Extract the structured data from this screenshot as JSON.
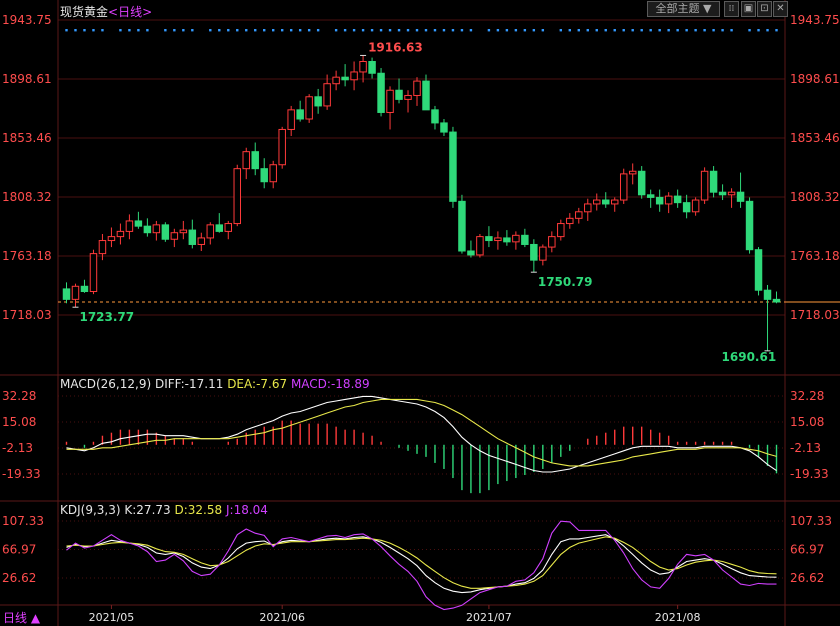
{
  "header": {
    "title": "现货黄金",
    "period_prefix": "<",
    "period": "日线",
    "period_suffix": ">",
    "theme_button": "全部主题",
    "theme_arrow": "▼",
    "win_buttons": [
      "⁞⁞",
      "▣",
      "⊡",
      "✕"
    ]
  },
  "macd": {
    "label": "MACD(26,12,9)",
    "diff_label": "DIFF:",
    "diff": "-17.11",
    "dea_label": "DEA:",
    "dea": "-7.67",
    "macd_label": "MACD:",
    "macd_value": "-18.89"
  },
  "kdj": {
    "label": "KDJ(9,3,3)",
    "k_label": "K:",
    "k": "27.73",
    "d_label": "D:",
    "d": "32.58",
    "j_label": "J:",
    "j": "18.04"
  },
  "footer": {
    "period": "日线",
    "arrow": "▲"
  },
  "colors": {
    "up": "#ff3a3a",
    "down": "#2fd97a",
    "axis_price": "#ff4d4d",
    "grid": "#4a1010",
    "diff_line": "#ffffff",
    "dea_line": "#e8e84a",
    "macd_text": "#d040ff",
    "j_line": "#d040ff",
    "high_label": "#ff4d4d",
    "low_label": "#2fd97a",
    "marker": "#3399ff"
  },
  "chart_data": [
    {
      "type": "candlestick",
      "name": "现货黄金 日线",
      "y_ticks": [
        1718.03,
        1763.18,
        1808.32,
        1853.46,
        1898.61,
        1943.75
      ],
      "ylim": [
        1718.03,
        1943.75
      ],
      "x_labels": [
        "2021/05",
        "2021/06",
        "2021/07",
        "2021/08"
      ],
      "annotations": [
        {
          "text": "1916.63",
          "type": "high"
        },
        {
          "text": "1723.77",
          "type": "low"
        },
        {
          "text": "1750.79",
          "type": "low"
        },
        {
          "text": "1690.61",
          "type": "low"
        }
      ],
      "last_price": 1728.0,
      "candles": [
        [
          1738,
          1743,
          1727,
          1730
        ],
        [
          1730,
          1742,
          1724,
          1740
        ],
        [
          1740,
          1745,
          1735,
          1736
        ],
        [
          1736,
          1768,
          1734,
          1765
        ],
        [
          1765,
          1780,
          1760,
          1775
        ],
        [
          1775,
          1785,
          1770,
          1778
        ],
        [
          1778,
          1788,
          1772,
          1782
        ],
        [
          1782,
          1795,
          1776,
          1790
        ],
        [
          1790,
          1797,
          1784,
          1786
        ],
        [
          1786,
          1792,
          1778,
          1781
        ],
        [
          1781,
          1790,
          1775,
          1787
        ],
        [
          1787,
          1789,
          1774,
          1776
        ],
        [
          1776,
          1784,
          1770,
          1781
        ],
        [
          1781,
          1790,
          1776,
          1783
        ],
        [
          1783,
          1791,
          1769,
          1772
        ],
        [
          1772,
          1781,
          1767,
          1777
        ],
        [
          1777,
          1789,
          1772,
          1787
        ],
        [
          1787,
          1796,
          1781,
          1782
        ],
        [
          1782,
          1790,
          1776,
          1788
        ],
        [
          1788,
          1833,
          1786,
          1830
        ],
        [
          1830,
          1846,
          1822,
          1843
        ],
        [
          1843,
          1850,
          1825,
          1830
        ],
        [
          1830,
          1838,
          1815,
          1820
        ],
        [
          1820,
          1836,
          1815,
          1833
        ],
        [
          1833,
          1862,
          1830,
          1860
        ],
        [
          1860,
          1878,
          1855,
          1875
        ],
        [
          1875,
          1882,
          1866,
          1868
        ],
        [
          1868,
          1887,
          1865,
          1885
        ],
        [
          1885,
          1891,
          1872,
          1878
        ],
        [
          1878,
          1902,
          1875,
          1895
        ],
        [
          1895,
          1905,
          1890,
          1900
        ],
        [
          1900,
          1910,
          1893,
          1898
        ],
        [
          1898,
          1912,
          1890,
          1904
        ],
        [
          1904,
          1916.63,
          1896,
          1912
        ],
        [
          1912,
          1915,
          1899,
          1903
        ],
        [
          1903,
          1907,
          1870,
          1873
        ],
        [
          1873,
          1893,
          1860,
          1890
        ],
        [
          1890,
          1899,
          1880,
          1883
        ],
        [
          1883,
          1890,
          1873,
          1886
        ],
        [
          1886,
          1900,
          1878,
          1897
        ],
        [
          1897,
          1902,
          1885,
          1875
        ],
        [
          1875,
          1878,
          1860,
          1865
        ],
        [
          1865,
          1868,
          1855,
          1858
        ],
        [
          1858,
          1862,
          1800,
          1805
        ],
        [
          1805,
          1810,
          1765,
          1767
        ],
        [
          1767,
          1775,
          1762,
          1764
        ],
        [
          1764,
          1780,
          1762,
          1778
        ],
        [
          1778,
          1786,
          1770,
          1775
        ],
        [
          1775,
          1782,
          1768,
          1777
        ],
        [
          1777,
          1783,
          1771,
          1774
        ],
        [
          1774,
          1782,
          1768,
          1779
        ],
        [
          1779,
          1784,
          1770,
          1772
        ],
        [
          1772,
          1776,
          1750.79,
          1760
        ],
        [
          1760,
          1772,
          1756,
          1770
        ],
        [
          1770,
          1782,
          1766,
          1778
        ],
        [
          1778,
          1791,
          1775,
          1788
        ],
        [
          1788,
          1796,
          1784,
          1792
        ],
        [
          1792,
          1800,
          1788,
          1797
        ],
        [
          1797,
          1807,
          1790,
          1803
        ],
        [
          1803,
          1811,
          1798,
          1806
        ],
        [
          1806,
          1812,
          1800,
          1803
        ],
        [
          1803,
          1808,
          1797,
          1806
        ],
        [
          1806,
          1830,
          1803,
          1826
        ],
        [
          1826,
          1834,
          1818,
          1828
        ],
        [
          1828,
          1832,
          1807,
          1810
        ],
        [
          1810,
          1814,
          1800,
          1808
        ],
        [
          1808,
          1814,
          1797,
          1803
        ],
        [
          1803,
          1812,
          1796,
          1809
        ],
        [
          1809,
          1814,
          1800,
          1804
        ],
        [
          1804,
          1810,
          1792,
          1797
        ],
        [
          1797,
          1808,
          1794,
          1806
        ],
        [
          1806,
          1831,
          1803,
          1828
        ],
        [
          1828,
          1832,
          1808,
          1812
        ],
        [
          1812,
          1818,
          1806,
          1810
        ],
        [
          1810,
          1815,
          1800,
          1812
        ],
        [
          1812,
          1827,
          1800,
          1805
        ],
        [
          1805,
          1808,
          1765,
          1768
        ],
        [
          1768,
          1770,
          1733,
          1737
        ],
        [
          1737,
          1741,
          1690.61,
          1730
        ],
        [
          1730,
          1736,
          1727,
          1728
        ]
      ]
    },
    {
      "type": "line",
      "name": "MACD",
      "y_ticks": [
        32.28,
        15.08,
        -2.13,
        -19.33
      ],
      "ylim": [
        -36.0,
        36.0
      ],
      "series": [
        {
          "name": "DIFF",
          "values": [
            -2,
            -3,
            -4,
            -2,
            1,
            2,
            4,
            5,
            6,
            7,
            7,
            6,
            6,
            6,
            5,
            4,
            4,
            4,
            5,
            7,
            10,
            12,
            14,
            16,
            19,
            21,
            22,
            24,
            26,
            28,
            29,
            30,
            31,
            32,
            32,
            31,
            30,
            29,
            28,
            27,
            25,
            22,
            18,
            12,
            5,
            0,
            -4,
            -7,
            -9,
            -11,
            -13,
            -15,
            -17,
            -18,
            -18,
            -17,
            -16,
            -14,
            -12,
            -10,
            -8,
            -6,
            -4,
            -2,
            -1,
            -1,
            -1,
            -1,
            -2,
            -2,
            -2,
            -1,
            -1,
            -1,
            -1,
            -2,
            -4,
            -8,
            -13,
            -17.11
          ]
        },
        {
          "name": "DEA",
          "values": [
            -3,
            -3,
            -3,
            -3,
            -2,
            -2,
            -1,
            0,
            1,
            2,
            3,
            3,
            4,
            4,
            4,
            4,
            4,
            4,
            4,
            5,
            6,
            7,
            8,
            10,
            11,
            13,
            15,
            17,
            19,
            21,
            23,
            25,
            26,
            28,
            29,
            30,
            30,
            30,
            30,
            30,
            29,
            28,
            26,
            23,
            20,
            16,
            12,
            8,
            4,
            1,
            -2,
            -5,
            -8,
            -10,
            -12,
            -13,
            -14,
            -14,
            -14,
            -13,
            -12,
            -11,
            -10,
            -8,
            -7,
            -6,
            -5,
            -4,
            -3,
            -3,
            -3,
            -2,
            -2,
            -2,
            -2,
            -2,
            -3,
            -4,
            -6,
            -7.67
          ]
        },
        {
          "name": "MACD",
          "values": [
            2,
            0,
            -2,
            2,
            6,
            8,
            10,
            10,
            10,
            10,
            8,
            6,
            4,
            4,
            2,
            0,
            0,
            0,
            2,
            4,
            8,
            10,
            12,
            12,
            16,
            16,
            14,
            14,
            14,
            14,
            12,
            10,
            10,
            8,
            6,
            2,
            0,
            -2,
            -4,
            -6,
            -8,
            -12,
            -16,
            -22,
            -30,
            -32,
            -32,
            -30,
            -26,
            -24,
            -22,
            -20,
            -18,
            -16,
            -12,
            -8,
            -4,
            0,
            4,
            6,
            8,
            10,
            12,
            12,
            12,
            10,
            8,
            6,
            2,
            2,
            2,
            2,
            2,
            2,
            2,
            0,
            -2,
            -8,
            -14,
            -18.89
          ]
        }
      ]
    },
    {
      "type": "line",
      "name": "KDJ",
      "y_ticks": [
        107.33,
        66.97,
        26.62
      ],
      "ylim": [
        -10,
        112
      ],
      "series": [
        {
          "name": "K",
          "values": [
            70,
            74,
            71,
            72,
            76,
            80,
            78,
            76,
            74,
            70,
            62,
            60,
            62,
            57,
            48,
            42,
            40,
            45,
            55,
            68,
            76,
            78,
            79,
            73,
            78,
            80,
            79,
            78,
            80,
            82,
            83,
            82,
            84,
            85,
            82,
            77,
            70,
            62,
            54,
            44,
            30,
            20,
            12,
            8,
            6,
            7,
            10,
            12,
            14,
            15,
            18,
            20,
            26,
            38,
            60,
            78,
            82,
            82,
            84,
            86,
            88,
            82,
            72,
            60,
            48,
            38,
            32,
            34,
            42,
            50,
            52,
            54,
            52,
            46,
            40,
            34,
            30,
            29,
            28,
            27.73
          ]
        },
        {
          "name": "D",
          "values": [
            72,
            73,
            72,
            72,
            74,
            76,
            77,
            76,
            75,
            73,
            68,
            64,
            63,
            60,
            54,
            48,
            44,
            45,
            50,
            58,
            66,
            72,
            75,
            74,
            76,
            78,
            78,
            78,
            79,
            80,
            81,
            81,
            82,
            83,
            82,
            80,
            76,
            70,
            63,
            55,
            45,
            36,
            27,
            20,
            15,
            12,
            12,
            13,
            14,
            15,
            16,
            18,
            22,
            30,
            45,
            60,
            70,
            76,
            79,
            82,
            85,
            83,
            77,
            70,
            60,
            50,
            42,
            38,
            40,
            45,
            49,
            51,
            52,
            50,
            46,
            42,
            37,
            34,
            33,
            32.58
          ]
        },
        {
          "name": "J",
          "values": [
            66,
            76,
            69,
            72,
            80,
            88,
            80,
            76,
            72,
            64,
            50,
            52,
            60,
            51,
            36,
            30,
            32,
            45,
            65,
            88,
            96,
            90,
            87,
            71,
            82,
            84,
            81,
            78,
            82,
            86,
            87,
            84,
            88,
            89,
            82,
            71,
            58,
            46,
            36,
            22,
            0,
            -12,
            -18,
            -16,
            -12,
            -3,
            6,
            10,
            14,
            15,
            22,
            24,
            34,
            54,
            90,
            107,
            106,
            94,
            94,
            94,
            94,
            80,
            62,
            40,
            24,
            14,
            12,
            26,
            46,
            60,
            58,
            60,
            52,
            38,
            28,
            18,
            16,
            19,
            18,
            18.04
          ]
        }
      ]
    }
  ]
}
